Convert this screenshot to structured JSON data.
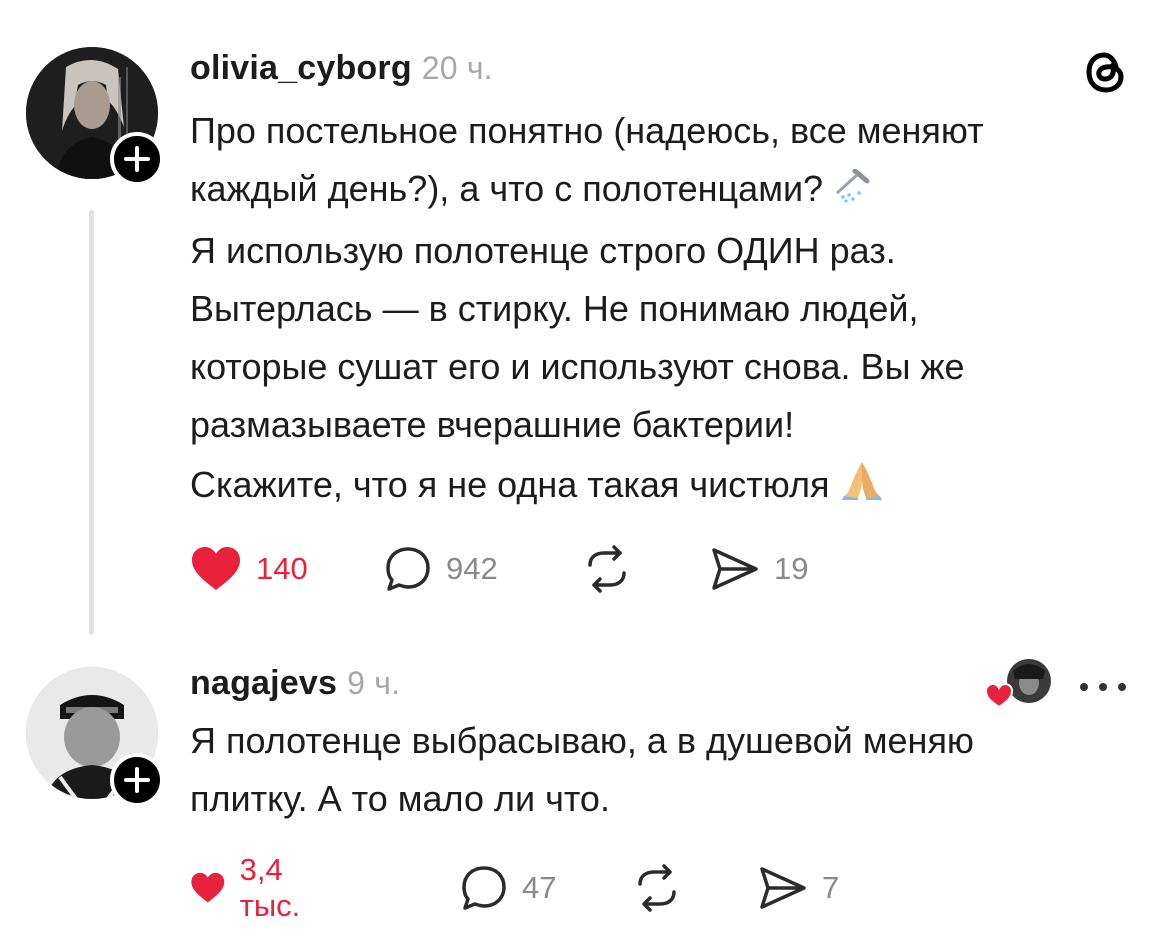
{
  "app": {
    "logo_icon": "threads-icon"
  },
  "posts": [
    {
      "username": "olivia_cyborg",
      "time": "20 ч.",
      "avatar_icon": "user-avatar",
      "follow_icon": "plus-icon",
      "paragraphs": [
        {
          "lines": [
            "Про постельное понятно (надеюсь, все меняют",
            "каждый день?), а что с полотенцами?"
          ],
          "emoji": "shower-emoji"
        },
        {
          "lines": [
            "Я использую полотенце строго ОДИН раз.",
            "Вытерлась — в стирку. Не понимаю людей,",
            "которые сушат его и используют снова. Вы же",
            "размазываете вчерашние бактерии!"
          ]
        },
        {
          "lines": [
            "Скажите, что я не одна такая чистюля"
          ],
          "emoji": "folded-hands-emoji"
        }
      ],
      "actions": {
        "likes": "140",
        "comments": "942",
        "shares": "19"
      }
    },
    {
      "username": "nagajevs",
      "time": "9 ч.",
      "avatar_icon": "user-avatar",
      "follow_icon": "plus-icon",
      "paragraphs": [
        {
          "lines": [
            "Я полотенце выбрасываю, а в душевой меняю",
            "плитку. А то мало ли что."
          ]
        }
      ],
      "actions": {
        "likes": "3,4 тыс.",
        "comments": "47",
        "shares": "7"
      }
    }
  ],
  "colors": {
    "like": "#e8213c",
    "muted": "#8a8a8a",
    "text": "#1c1c1c"
  }
}
